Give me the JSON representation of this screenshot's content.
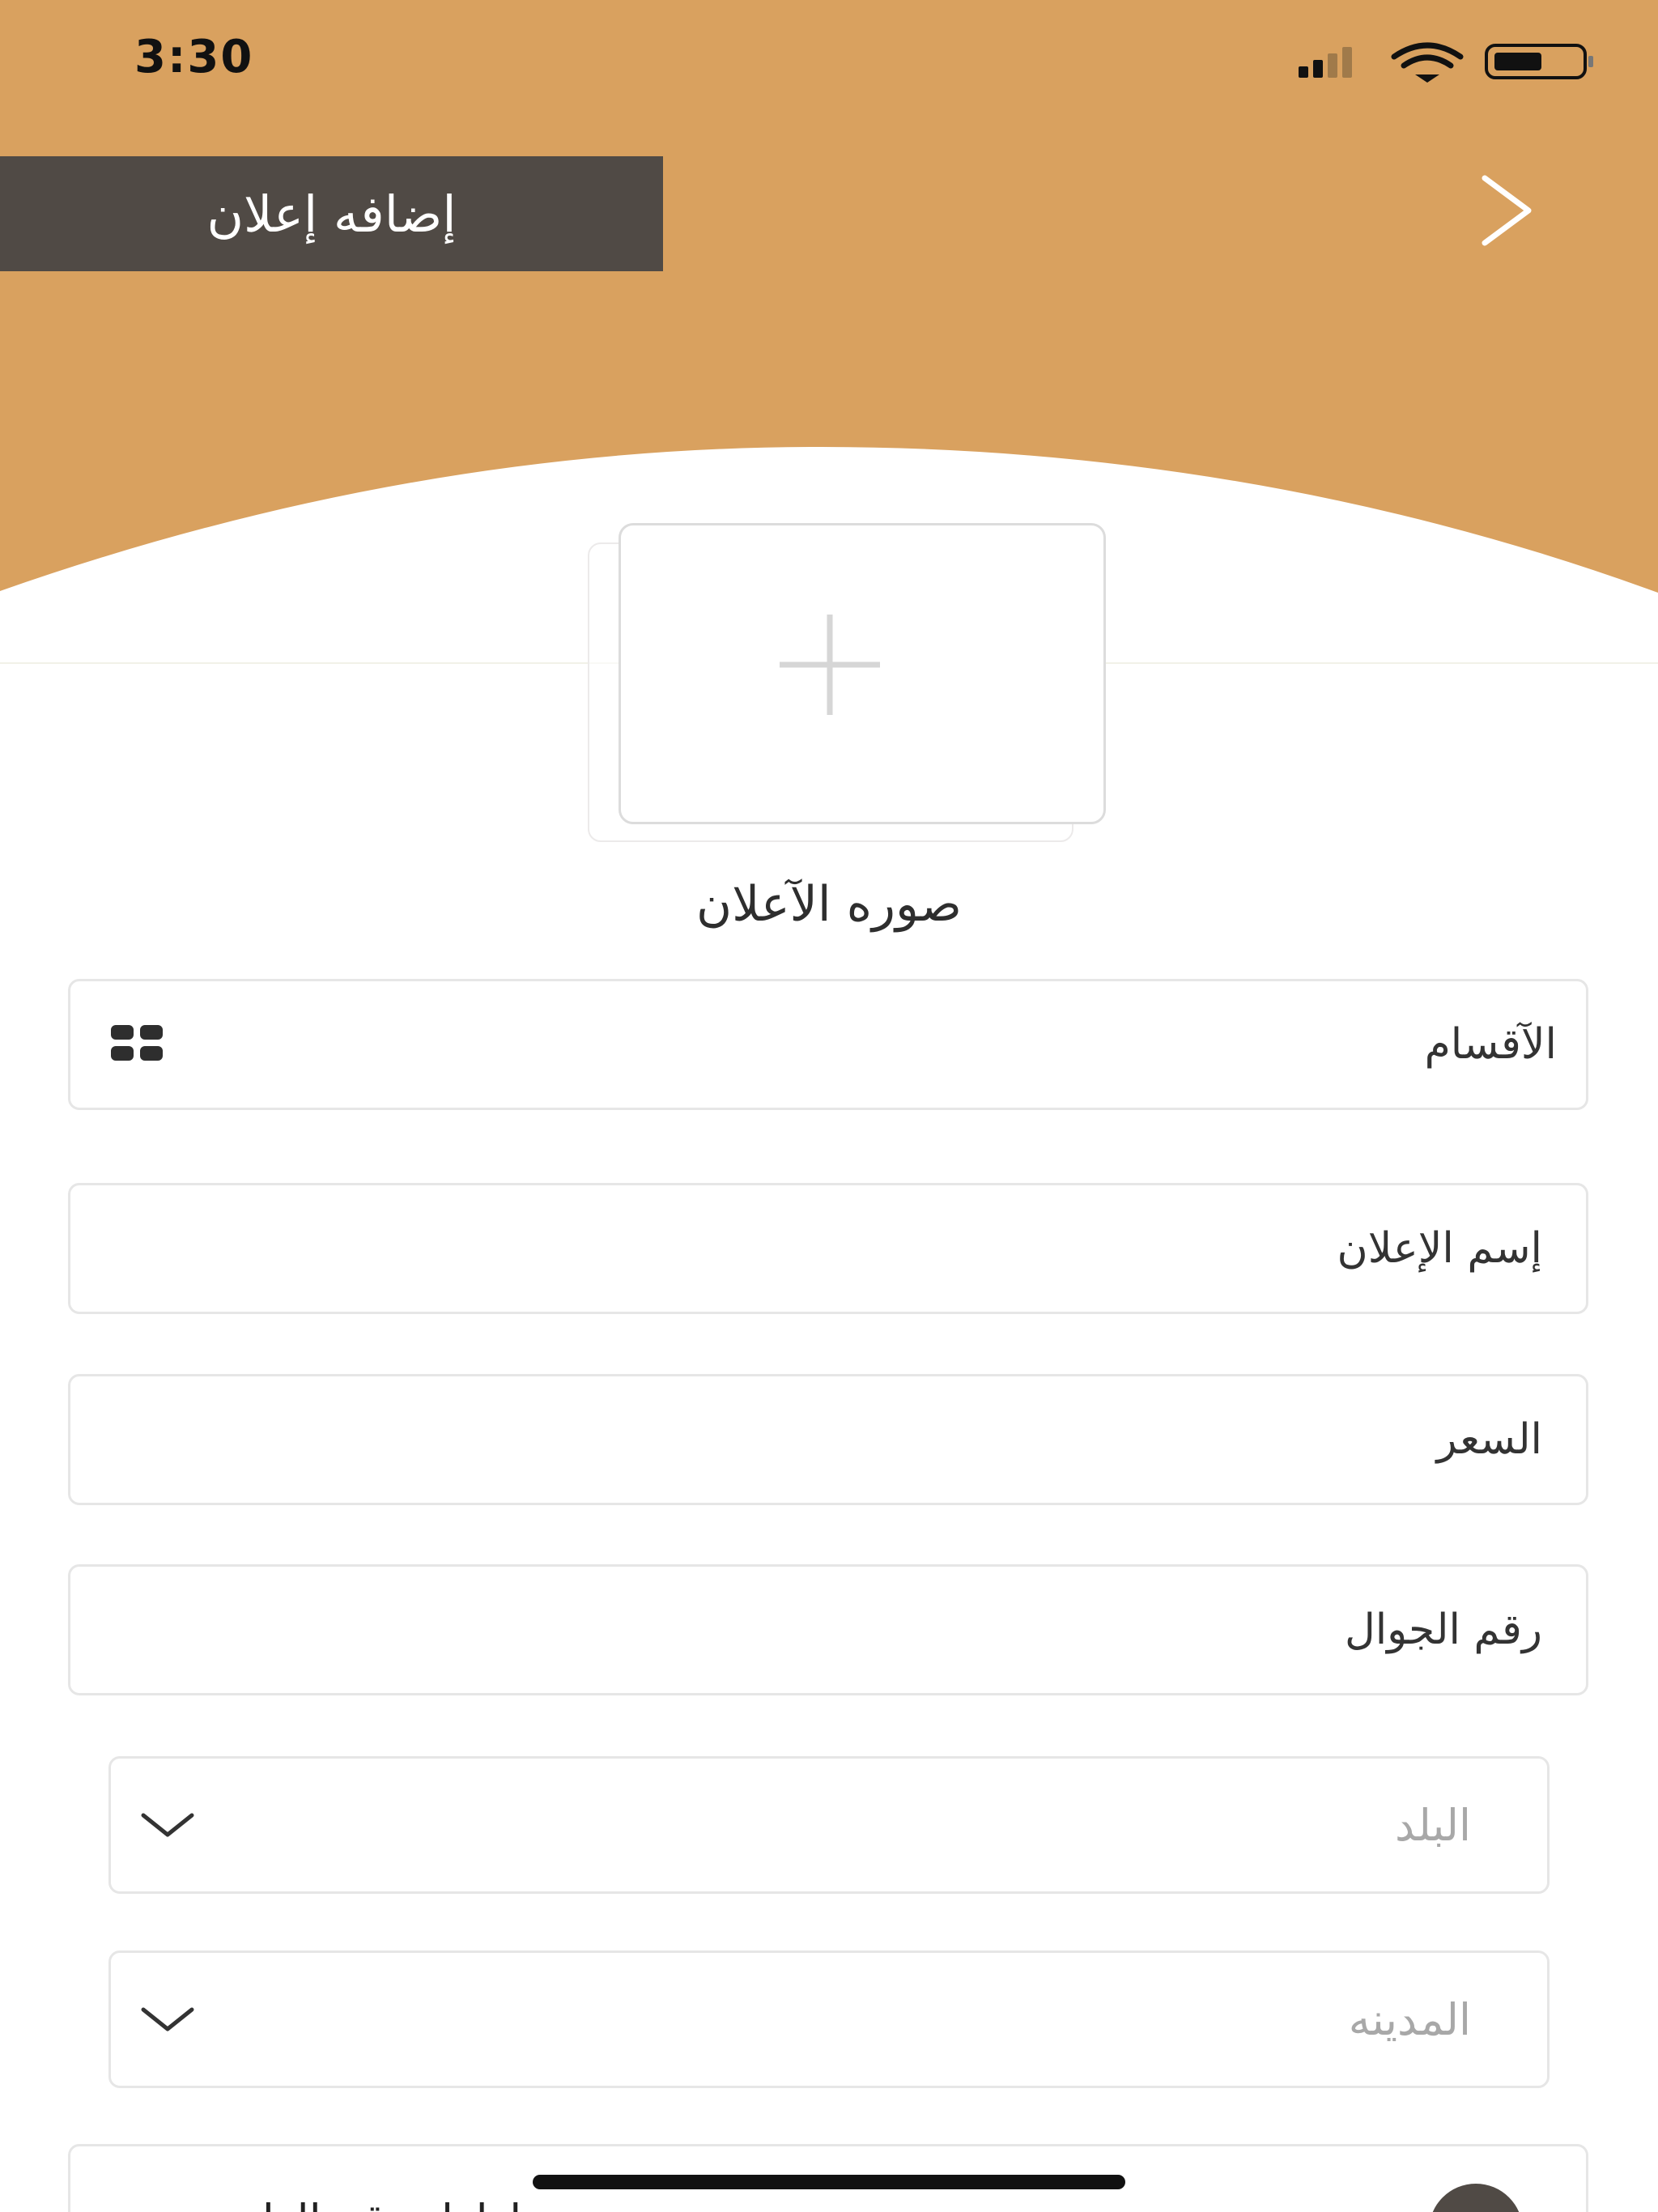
{
  "status_bar": {
    "time": "3:30"
  },
  "header": {
    "title": "إضافه إعلان",
    "accent_color": "#d9a15f",
    "title_bar_color": "#504a45"
  },
  "image_picker": {
    "label": "صوره الآعلان",
    "icon": "plus-icon"
  },
  "form": {
    "category": {
      "label": "الآقسام",
      "icon": "grid-icon"
    },
    "ad_name": {
      "placeholder": "إسم الإعلان"
    },
    "price": {
      "placeholder": "السعر"
    },
    "mobile": {
      "placeholder": "رقم الجوال"
    },
    "country": {
      "placeholder": "البلد",
      "icon": "chevron-down-icon"
    },
    "city": {
      "placeholder": "المدينه",
      "icon": "chevron-down-icon"
    },
    "show_phone": {
      "label": "إظهار رقم الهاتف"
    }
  }
}
